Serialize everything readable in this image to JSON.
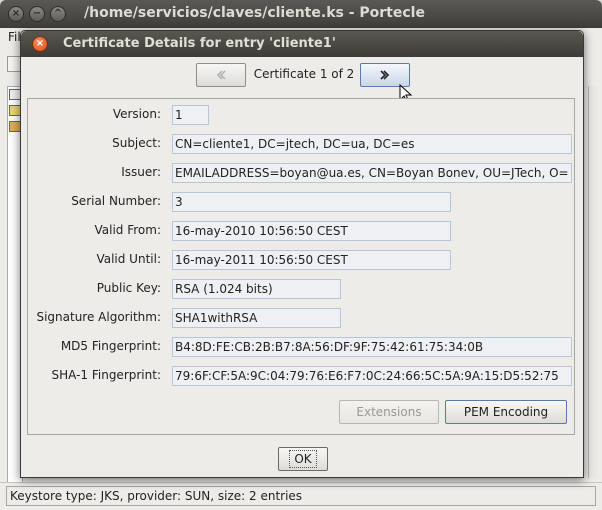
{
  "main_window": {
    "title": "/home/servicios/claves/cliente.ks - Portecle",
    "menu_fragment": "Fil",
    "status": "Keystore type: JKS, provider: SUN, size: 2 entries"
  },
  "dialog": {
    "title": "Certificate Details for entry 'cliente1'",
    "navigation": {
      "label": "Certificate 1 of 2",
      "prev_icon": "chevron-left-icon",
      "next_icon": "chevron-right-icon"
    },
    "fields": [
      {
        "label": "Version:",
        "value": "1"
      },
      {
        "label": "Subject:",
        "value": "CN=cliente1, DC=jtech, DC=ua, DC=es"
      },
      {
        "label": "Issuer:",
        "value": "EMAILADDRESS=boyan@ua.es, CN=Boyan Bonev, OU=JTech, O="
      },
      {
        "label": "Serial Number:",
        "value": "3"
      },
      {
        "label": "Valid From:",
        "value": "16-may-2010 10:56:50 CEST"
      },
      {
        "label": "Valid Until:",
        "value": "16-may-2011 10:56:50 CEST"
      },
      {
        "label": "Public Key:",
        "value": "RSA (1.024 bits)"
      },
      {
        "label": "Signature Algorithm:",
        "value": "SHA1withRSA"
      },
      {
        "label": "MD5 Fingerprint:",
        "value": "B4:8D:FE:CB:2B:B7:8A:56:DF:9F:75:42:61:75:34:0B"
      },
      {
        "label": "SHA-1 Fingerprint:",
        "value": "79:6F:CF:5A:9C:04:79:76:E6:F7:0C:24:66:5C:5A:9A:15:D5:52:75"
      }
    ],
    "buttons": {
      "extensions": "Extensions",
      "pem_encoding": "PEM Encoding",
      "ok": "OK"
    }
  }
}
